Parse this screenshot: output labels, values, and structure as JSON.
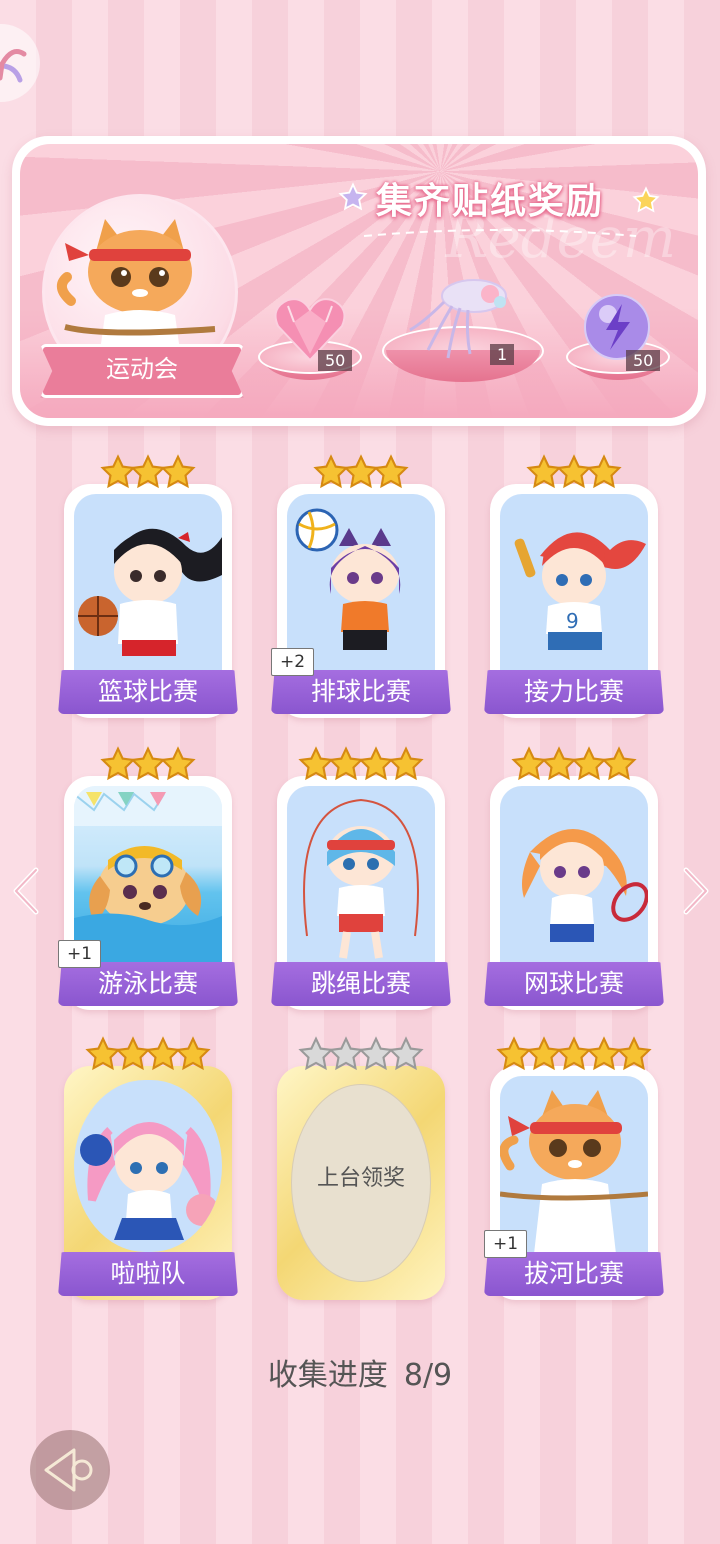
{
  "banner": {
    "title": "集齐贴纸奖励",
    "watermark": "Redeem",
    "event_name": "运动会",
    "rewards": [
      {
        "icon": "pink-heart-gem-icon",
        "count": "50"
      },
      {
        "icon": "jellyfish-ornament-icon",
        "count": "1"
      },
      {
        "icon": "purple-energy-orb-icon",
        "count": "50"
      }
    ]
  },
  "cards": [
    {
      "label": "篮球比赛",
      "stars": 3,
      "badge": null,
      "art": "basketball-girl"
    },
    {
      "label": "排球比赛",
      "stars": 3,
      "badge": "+2",
      "art": "volleyball-girl"
    },
    {
      "label": "接力比赛",
      "stars": 3,
      "badge": null,
      "art": "relay-girl"
    },
    {
      "label": "游泳比赛",
      "stars": 3,
      "badge": "+1",
      "art": "swimming-dog"
    },
    {
      "label": "跳绳比赛",
      "stars": 4,
      "badge": null,
      "art": "jump-rope-girl"
    },
    {
      "label": "网球比赛",
      "stars": 4,
      "badge": null,
      "art": "tennis-girl"
    },
    {
      "label": "啦啦队",
      "stars": 4,
      "badge": null,
      "art": "cheerleader-girl"
    },
    {
      "label": "上台领奖",
      "stars": 4,
      "badge": null,
      "art": "locked",
      "locked": true
    },
    {
      "label": "拔河比赛",
      "stars": 5,
      "badge": "+1",
      "art": "tug-of-war-cat"
    }
  ],
  "progress": {
    "label": "收集进度",
    "value": "8/9",
    "collected": 8,
    "total": 9
  },
  "colors": {
    "label_purple": "#9a63d8",
    "star_gold": "#f6c232",
    "pink_bg": "#fbdde5"
  }
}
